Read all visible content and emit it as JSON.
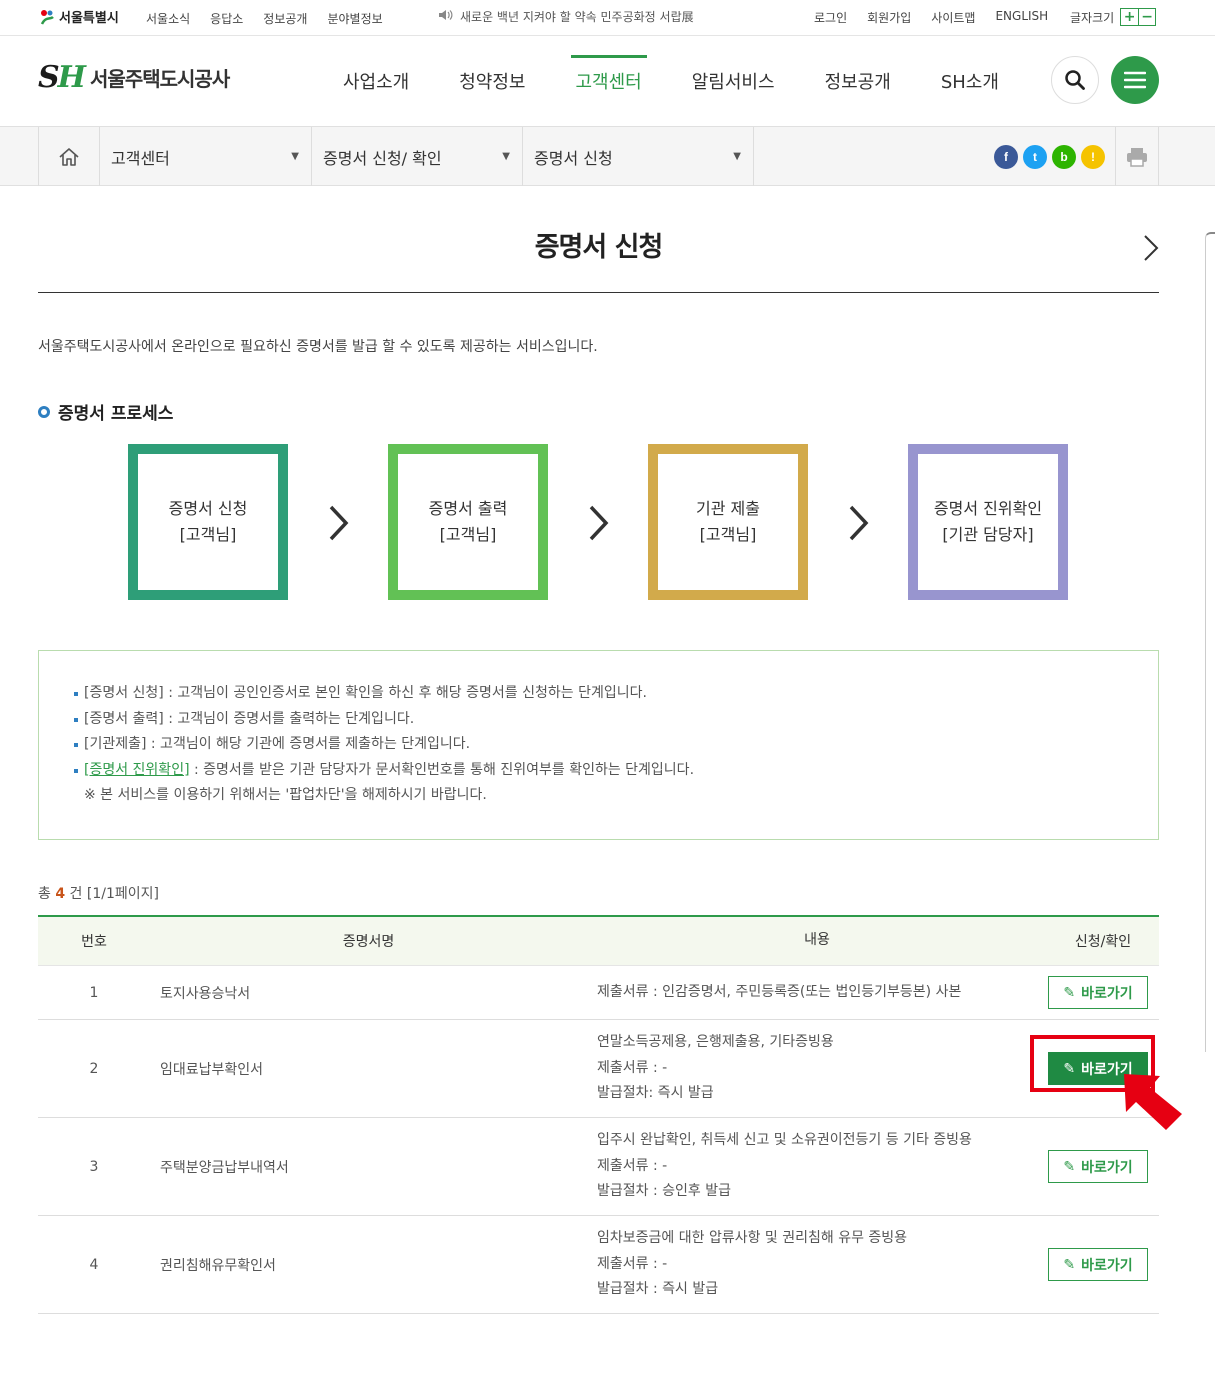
{
  "util": {
    "seoul_logo": "서울특별시",
    "links_left": [
      "서울소식",
      "응답소",
      "정보공개",
      "분야별정보"
    ],
    "notice": "새로운 백년 지켜야 할 약속 민주공화정 서랍展",
    "links_right": [
      "로그인",
      "회원가입",
      "사이트맵",
      "ENGLISH"
    ],
    "font_size_label": "글자크기",
    "font_plus": "+",
    "font_minus": "−"
  },
  "header": {
    "logo_s": "S",
    "logo_h": "H",
    "logo_name": "서울주택도시공사",
    "gnb": [
      "사업소개",
      "청약정보",
      "고객센터",
      "알림서비스",
      "정보공개",
      "SH소개"
    ],
    "active_gnb": "고객센터"
  },
  "location": {
    "depth1": "고객센터",
    "depth2": "증명서 신청/ 확인",
    "depth3": "증명서 신청",
    "sns": [
      {
        "label": "f",
        "color": "#3b5998"
      },
      {
        "label": "t",
        "color": "#1da1f2"
      },
      {
        "label": "b",
        "color": "#2db400"
      },
      {
        "label": "!",
        "color": "#f5c300"
      }
    ]
  },
  "page": {
    "title": "증명서 신청",
    "intro": "서울주택도시공사에서 온라인으로 필요하신 증명서를 발급 할 수 있도록 제공하는 서비스입니다.",
    "section_title": "증명서 프로세스"
  },
  "process": [
    {
      "line1": "증명서 신청",
      "line2": "[고객님]",
      "color": "#2e9e78"
    },
    {
      "line1": "증명서 출력",
      "line2": "[고객님]",
      "color": "#62c155"
    },
    {
      "line1": "기관 제출",
      "line2": "[고객님]",
      "color": "#d2aa4b"
    },
    {
      "line1": "증명서 진위확인",
      "line2": "[기관 담당자]",
      "color": "#9895cf"
    }
  ],
  "info": {
    "item1": "[증명서 신청] : 고객님이 공인인증서로 본인 확인을 하신 후 해당 증명서를 신청하는 단계입니다.",
    "item2": "[증명서 출력] : 고객님이 증명서를 출력하는 단계입니다.",
    "item3": "[기관제출] : 고객님이 해당 기관에 증명서를 제출하는 단계입니다.",
    "item4_link": "[증명서 진위확인]",
    "item4_rest": " : 증명서를 받은 기관 담당자가 문서확인번호를 통해 진위여부를 확인하는 단계입니다.",
    "note": "※ 본 서비스를 이용하기 위해서는 '팝업차단'을 해제하시기 바랍니다."
  },
  "total": {
    "prefix": "총 ",
    "count": "4",
    "suffix": " 건 [1/1페이지]"
  },
  "table": {
    "headers": {
      "no": "번호",
      "name": "증명서명",
      "desc": "내용",
      "action": "신청/확인"
    },
    "go_label": "바로가기",
    "rows": [
      {
        "no": "1",
        "name": "토지사용승낙서",
        "desc1": "제출서류 : 인감증명서, 주민등록증(또는 법인등기부등본) 사본",
        "desc2": "",
        "desc3": ""
      },
      {
        "no": "2",
        "name": "임대료납부확인서",
        "desc1": "연말소득공제용, 은행제출용, 기타증빙용",
        "desc2": "제출서류 : -",
        "desc3": "발급절차: 즉시 발급"
      },
      {
        "no": "3",
        "name": "주택분양금납부내역서",
        "desc1": "입주시 완납확인, 취득세 신고 및 소유권이전등기 등 기타 증빙용",
        "desc2": "제출서류 : -",
        "desc3": "발급절차 : 승인후 발급"
      },
      {
        "no": "4",
        "name": "권리침해유무확인서",
        "desc1": "임차보증금에 대한 압류사항 및 권리침해 유무 증빙용",
        "desc2": "제출서류 : -",
        "desc3": "발급절차 : 즉시 발급"
      }
    ]
  },
  "colors": {
    "brand": "#2e9a4a",
    "highlight": "#e60012"
  }
}
